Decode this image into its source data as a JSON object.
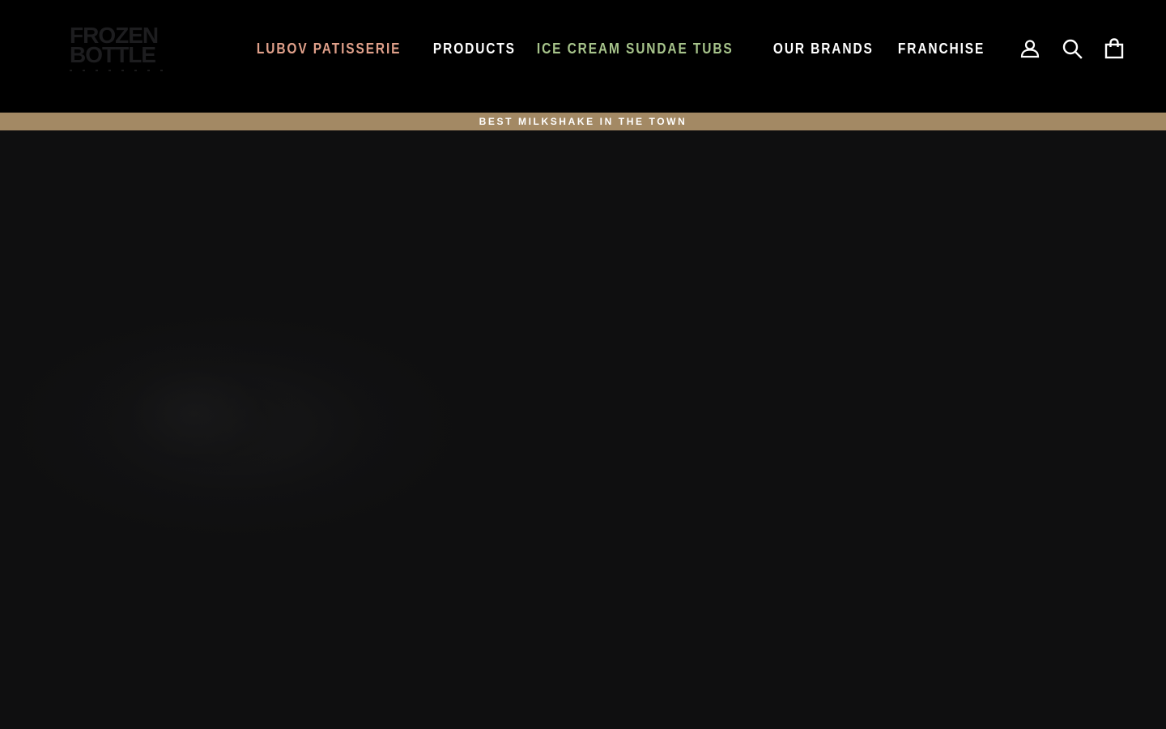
{
  "brand": {
    "logo_line1": "FROZEN",
    "logo_line2": "BOTTLE"
  },
  "nav": {
    "items": [
      {
        "label": "LUBOV PATISSERIE",
        "color": "#e0a08a"
      },
      {
        "label": "PRODUCTS",
        "color": "#ffffff"
      },
      {
        "label": "ICE CREAM SUNDAE TUBS",
        "color": "#a7c48b"
      },
      {
        "label": "OUR BRANDS",
        "color": "#ffffff"
      },
      {
        "label": "FRANCHISE",
        "color": "#ffffff"
      }
    ]
  },
  "header_icons": {
    "login": "user-icon",
    "search": "search-icon",
    "cart": "cart-icon"
  },
  "announcement": {
    "text": "BEST MILKSHAKE IN THE TOWN",
    "background": "#a38964"
  },
  "colors": {
    "header_bg": "#000000",
    "page_bg": "#0f0f10"
  }
}
